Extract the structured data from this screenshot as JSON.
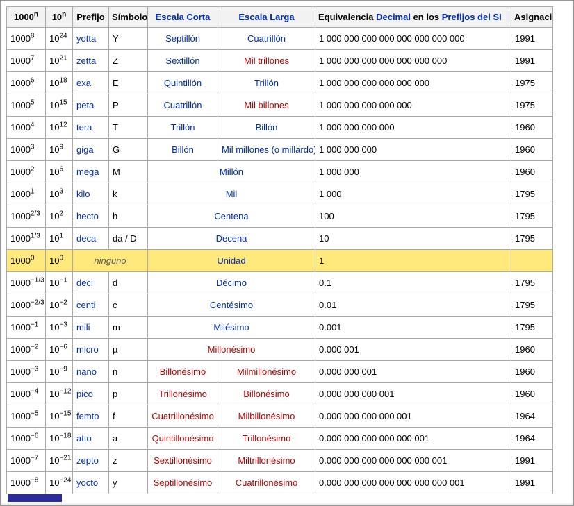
{
  "colors": {
    "link_blue": "#002bb8",
    "link_red": "#ba0000",
    "header_bg": "#f2f2f2",
    "table_border": "#aaaaaa",
    "highlight_row": "#ffe87c",
    "bottom_bar": "#2b2b9b"
  },
  "table": {
    "headers": {
      "col1_base": "1000",
      "col1_sup": "n",
      "col2_base": "10",
      "col2_sup": "n",
      "prefijo": "Prefijo",
      "simbolo": "Símbolo",
      "escala_corta": "Escala Corta",
      "escala_larga": "Escala Larga",
      "equiv_text1": "Equivalencia ",
      "equiv_link1": "Decimal",
      "equiv_text2": " en los ",
      "equiv_link2": "Prefijos del SI",
      "asignacion": "Asignación"
    },
    "rows": [
      {
        "p1000": {
          "base": "1000",
          "exp": "8"
        },
        "p10": {
          "base": "10",
          "exp": "24"
        },
        "prefijo": "yotta",
        "simbolo": "Y",
        "corta": {
          "text": "Septillón",
          "red": false
        },
        "larga": {
          "text": "Cuatrillón",
          "red": false
        },
        "equiv": "1 000 000 000 000 000 000 000 000",
        "asig": "1991"
      },
      {
        "p1000": {
          "base": "1000",
          "exp": "7"
        },
        "p10": {
          "base": "10",
          "exp": "21"
        },
        "prefijo": "zetta",
        "simbolo": "Z",
        "corta": {
          "text": "Sextillón",
          "red": false
        },
        "larga": {
          "text": "Mil trillones",
          "red": true
        },
        "equiv": "1 000 000 000 000 000 000 000",
        "asig": "1991"
      },
      {
        "p1000": {
          "base": "1000",
          "exp": "6"
        },
        "p10": {
          "base": "10",
          "exp": "18"
        },
        "prefijo": "exa",
        "simbolo": "E",
        "corta": {
          "text": "Quintillón",
          "red": false
        },
        "larga": {
          "text": "Trillón",
          "red": false
        },
        "equiv": "1 000 000 000 000 000 000",
        "asig": "1975"
      },
      {
        "p1000": {
          "base": "1000",
          "exp": "5"
        },
        "p10": {
          "base": "10",
          "exp": "15"
        },
        "prefijo": "peta",
        "simbolo": "P",
        "corta": {
          "text": "Cuatrillón",
          "red": false
        },
        "larga": {
          "text": "Mil billones",
          "red": true
        },
        "equiv": "1 000 000 000 000 000",
        "asig": "1975"
      },
      {
        "p1000": {
          "base": "1000",
          "exp": "4"
        },
        "p10": {
          "base": "10",
          "exp": "12"
        },
        "prefijo": "tera",
        "simbolo": "T",
        "corta": {
          "text": "Trillón",
          "red": false
        },
        "larga": {
          "text": "Billón",
          "red": false
        },
        "equiv": "1 000 000 000 000",
        "asig": "1960"
      },
      {
        "p1000": {
          "base": "1000",
          "exp": "3"
        },
        "p10": {
          "base": "10",
          "exp": "9"
        },
        "prefijo": "giga",
        "simbolo": "G",
        "corta": {
          "text": "Billón",
          "red": false
        },
        "larga": {
          "text": "Mil millones (o millardo)",
          "red": false
        },
        "equiv": "1 000 000 000",
        "asig": "1960"
      },
      {
        "p1000": {
          "base": "1000",
          "exp": "2"
        },
        "p10": {
          "base": "10",
          "exp": "6"
        },
        "prefijo": "mega",
        "simbolo": "M",
        "escala": {
          "text": "Millón",
          "red": false
        },
        "equiv": "1 000 000",
        "asig": "1960"
      },
      {
        "p1000": {
          "base": "1000",
          "exp": "1"
        },
        "p10": {
          "base": "10",
          "exp": "3"
        },
        "prefijo": "kilo",
        "simbolo": "k",
        "escala": {
          "text": "Mil",
          "red": false
        },
        "equiv": "1 000",
        "asig": "1795"
      },
      {
        "p1000": {
          "base": "1000",
          "exp": "2/3"
        },
        "p10": {
          "base": "10",
          "exp": "2"
        },
        "prefijo": "hecto",
        "simbolo": "h",
        "escala": {
          "text": "Centena",
          "red": false
        },
        "equiv": "100",
        "asig": "1795"
      },
      {
        "p1000": {
          "base": "1000",
          "exp": "1/3"
        },
        "p10": {
          "base": "10",
          "exp": "1"
        },
        "prefijo": "deca",
        "simbolo": "da / D",
        "escala": {
          "text": "Decena",
          "red": false
        },
        "equiv": "10",
        "asig": "1795"
      },
      {
        "p1000": {
          "base": "1000",
          "exp": "0"
        },
        "p10": {
          "base": "10",
          "exp": "0"
        },
        "ninguno": "ninguno",
        "escala": {
          "text": "Unidad",
          "red": false
        },
        "equiv": "1",
        "asig": "",
        "highlight": true
      },
      {
        "p1000": {
          "base": "1000",
          "exp": "−1/3"
        },
        "p10": {
          "base": "10",
          "exp": "−1"
        },
        "prefijo": "deci",
        "simbolo": "d",
        "escala": {
          "text": "Décimo",
          "red": false
        },
        "equiv": "0.1",
        "asig": "1795"
      },
      {
        "p1000": {
          "base": "1000",
          "exp": "−2/3"
        },
        "p10": {
          "base": "10",
          "exp": "−2"
        },
        "prefijo": "centi",
        "simbolo": "c",
        "escala": {
          "text": "Centésimo",
          "red": false
        },
        "equiv": "0.01",
        "asig": "1795"
      },
      {
        "p1000": {
          "base": "1000",
          "exp": "−1"
        },
        "p10": {
          "base": "10",
          "exp": "−3"
        },
        "prefijo": "mili",
        "simbolo": "m",
        "escala": {
          "text": "Milésimo",
          "red": false
        },
        "equiv": "0.001",
        "asig": "1795"
      },
      {
        "p1000": {
          "base": "1000",
          "exp": "−2"
        },
        "p10": {
          "base": "10",
          "exp": "−6"
        },
        "prefijo": "micro",
        "simbolo": "µ",
        "escala": {
          "text": "Millonésimo",
          "red": true
        },
        "equiv": "0.000 001",
        "asig": "1960"
      },
      {
        "p1000": {
          "base": "1000",
          "exp": "−3"
        },
        "p10": {
          "base": "10",
          "exp": "−9"
        },
        "prefijo": "nano",
        "simbolo": "n",
        "corta": {
          "text": "Billonésimo",
          "red": true
        },
        "larga": {
          "text": "Milmillonésimo",
          "red": true
        },
        "equiv": "0.000 000 001",
        "asig": "1960"
      },
      {
        "p1000": {
          "base": "1000",
          "exp": "−4"
        },
        "p10": {
          "base": "10",
          "exp": "−12"
        },
        "prefijo": "pico",
        "simbolo": "p",
        "corta": {
          "text": "Trillonésimo",
          "red": true
        },
        "larga": {
          "text": "Billonésimo",
          "red": true
        },
        "equiv": "0.000 000 000 001",
        "asig": "1960"
      },
      {
        "p1000": {
          "base": "1000",
          "exp": "−5"
        },
        "p10": {
          "base": "10",
          "exp": "−15"
        },
        "prefijo": "femto",
        "simbolo": "f",
        "corta": {
          "text": "Cuatrillonésimo",
          "red": true
        },
        "larga": {
          "text": "Milbillonésimo",
          "red": true
        },
        "equiv": "0.000 000 000 000 001",
        "asig": "1964"
      },
      {
        "p1000": {
          "base": "1000",
          "exp": "−6"
        },
        "p10": {
          "base": "10",
          "exp": "−18"
        },
        "prefijo": "atto",
        "simbolo": "a",
        "corta": {
          "text": "Quintillonésimo",
          "red": true
        },
        "larga": {
          "text": "Trillonésimo",
          "red": true
        },
        "equiv": "0.000 000 000 000 000 001",
        "asig": "1964"
      },
      {
        "p1000": {
          "base": "1000",
          "exp": "−7"
        },
        "p10": {
          "base": "10",
          "exp": "−21"
        },
        "prefijo": "zepto",
        "simbolo": "z",
        "corta": {
          "text": "Sextillonésimo",
          "red": true
        },
        "larga": {
          "text": "Miltrillonésimo",
          "red": true
        },
        "equiv": "0.000 000 000 000 000 000 001",
        "asig": "1991"
      },
      {
        "p1000": {
          "base": "1000",
          "exp": "−8"
        },
        "p10": {
          "base": "10",
          "exp": "−24"
        },
        "prefijo": "yocto",
        "simbolo": "y",
        "corta": {
          "text": "Septillonésimo",
          "red": true
        },
        "larga": {
          "text": "Cuatrillonésimo",
          "red": true
        },
        "equiv": "0.000 000 000 000 000 000 000 001",
        "asig": "1991"
      }
    ]
  }
}
